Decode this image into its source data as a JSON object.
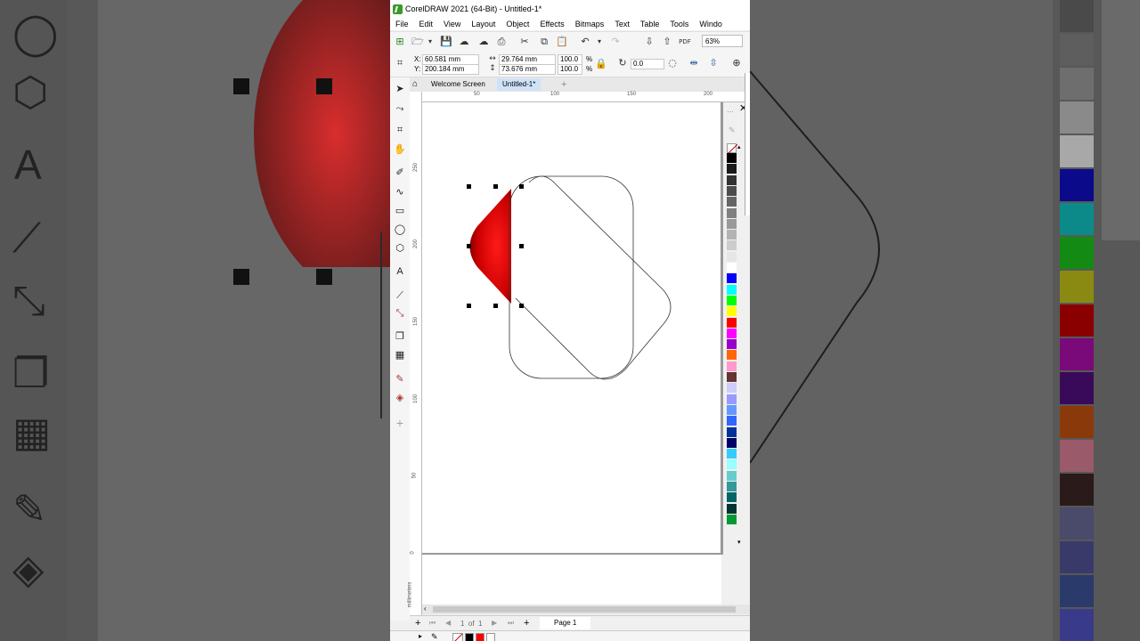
{
  "app": {
    "title": "CorelDRAW 2021 (64-Bit) - Untitled-1*",
    "menus": [
      "File",
      "Edit",
      "View",
      "Layout",
      "Object",
      "Effects",
      "Bitmaps",
      "Text",
      "Table",
      "Tools",
      "Windo"
    ]
  },
  "toolbar": {
    "zoom": "63%",
    "pdf_label": "PDF"
  },
  "properties": {
    "x_label": "X:",
    "x_value": "60.581 mm",
    "y_label": "Y:",
    "y_value": "200.184 mm",
    "width_value": "29.764 mm",
    "height_value": "73.676 mm",
    "scale_w": "100.0",
    "scale_h": "100.0",
    "percent": "%",
    "rotation": "0.0"
  },
  "tabs": {
    "welcome": "Welcome Screen",
    "document": "Untitled-1*",
    "add": "+"
  },
  "rulers": {
    "h_ticks": [
      "50",
      "100",
      "150",
      "200"
    ],
    "v_ticks": [
      "250",
      "200",
      "150",
      "100",
      "50",
      "0"
    ],
    "unit": "millimeters"
  },
  "pagebar": {
    "page_count": "1  of  1",
    "page_tab": "Page 1"
  },
  "palette": {
    "colors": [
      "#000000",
      "#1a1a1a",
      "#333333",
      "#4d4d4d",
      "#666666",
      "#808080",
      "#999999",
      "#b3b3b3",
      "#cccccc",
      "#e6e6e6",
      "#ffffff",
      "#0000ff",
      "#00ffff",
      "#00ff00",
      "#ffff00",
      "#ff0000",
      "#ff00ff",
      "#9900cc",
      "#ff6600",
      "#ff99cc",
      "#663333",
      "#ccccff",
      "#9999ff",
      "#6699ff",
      "#3366ff",
      "#003399",
      "#000066",
      "#33ccff",
      "#99ffff",
      "#66cccc",
      "#339999",
      "#006666",
      "#003333",
      "#009933"
    ]
  },
  "background_palette": {
    "colors": [
      "#4a4a4a",
      "#5e5e5e",
      "#6e6e6e",
      "#8a8a8a",
      "#a8a8a8",
      "#0a0a8a",
      "#0c8a8a",
      "#138a13",
      "#8a8a13",
      "#8a0000",
      "#7a0a7a",
      "#3a0a5a",
      "#8a3a0a",
      "#9a5a6a",
      "#2a1a1a",
      "#4a4a6a",
      "#3a3a6a",
      "#2a3a6a",
      "#3a3a8a"
    ]
  },
  "status": {
    "colors": [
      "#000000",
      "#ff0000",
      "#ffffff"
    ]
  }
}
